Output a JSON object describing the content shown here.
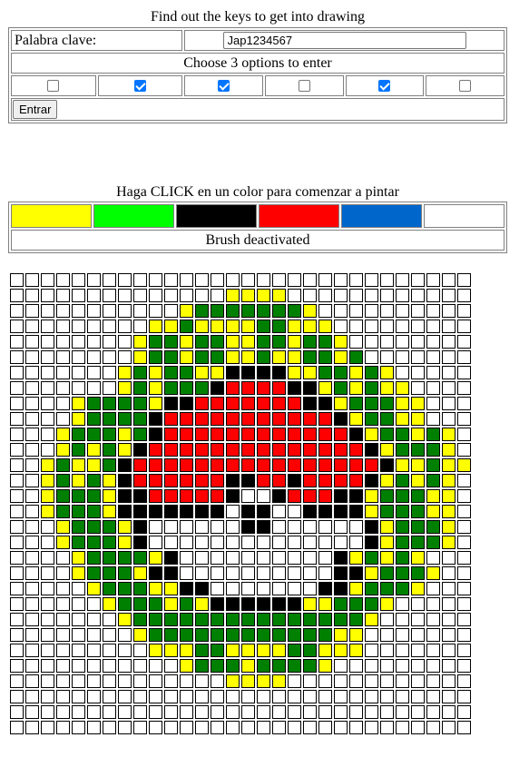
{
  "login": {
    "title": "Find out the keys to get into drawing",
    "keyword_label": "Palabra clave:",
    "keyword_value": "Jap1234567",
    "options_instruction": "Choose 3 options to enter",
    "checkboxes": [
      false,
      true,
      true,
      false,
      true,
      false
    ],
    "enter_label": "Entrar"
  },
  "palette": {
    "instruction": "Haga CLICK en un color para comenzar a pintar",
    "colors": [
      "#ffff00",
      "#00ff00",
      "#000000",
      "#ff0000",
      "#0066cc",
      "#ffffff"
    ],
    "brush_status": "Brush deactivated"
  },
  "canvas": {
    "columns": 30,
    "rows": 30,
    "legend": {
      ".": "#ffffff",
      "Y": "#ffff00",
      "G": "#008000",
      "K": "#000000",
      "R": "#ff0000"
    },
    "pixels": [
      "..............................",
      "..............YYYY............",
      "...........YGGGGGGGY..........",
      ".........YYGYYYYGGYYY.........",
      "........YGGYGGYYGGYGGY........",
      "........YGGYGGYYGYYGGYG.......",
      ".......YGYGGYYKKKKYYGGYGY.....",
      ".......YGYGGGKRRRRKKYGYGYY....",
      "....YGGGGYKKRRRRRRRKKYGGGYY...",
      "....YGGGGKRRRRRRRRRRRKYGGYY...",
      "...YGGGYGKRRRRRRRRRRRRKYGGYGY.",
      "...YGYGYKRRRRRRRRRRRRRRKYGGGY.",
      "..YGYYGKRRRRRRRRRRRRRRRRKYYGYY",
      "..YGYGYKRRRRRRKKRRKRRRRKYGYGY.",
      "..YGGGYKKRRRRRK..KRRRKKYGGGYY.",
      "..YGGGYKKKKKKK.KK..KKKKYGGGYY.",
      "...YGGGYK......KK......KYGGGY.",
      "...YGGGYK..............KYGGGY.",
      "....YGGGGYK..........KYGYGY...",
      "....YGGGYKK..........KKYGGGY..",
      ".....YGGGYYKK.......KKYGGGY...",
      "......YGGGYGYKKKKKKYYGGGY.....",
      ".......YGGGGGGGGGGGGGGGY......",
      "........YGGGGGGGGGGGGYY.......",
      ".........YYYGGYYYYGGYYY.......",
      "...........YGGGYGGGGY.........",
      "..............YYYY............",
      "..............................",
      "..............................",
      ".............................."
    ]
  }
}
